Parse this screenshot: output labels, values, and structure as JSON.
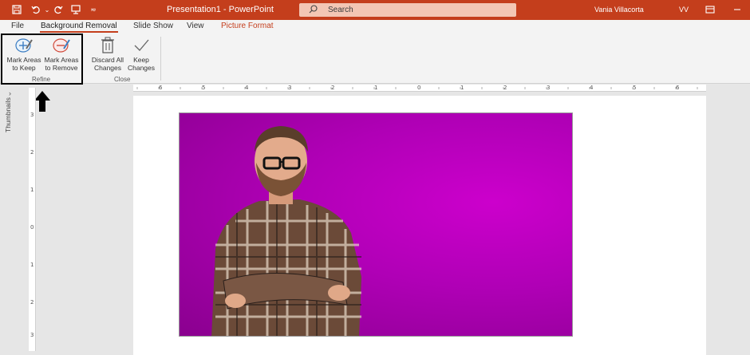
{
  "titlebar": {
    "doc_title": "Presentation1 - PowerPoint",
    "search_placeholder": "Search",
    "user_name": "Vania Villacorta",
    "user_initials": "VV",
    "bg_color": "#c43e1c"
  },
  "tabs": [
    "File",
    "Background Removal",
    "Slide Show",
    "View",
    "Picture Format"
  ],
  "ribbon": {
    "refine": {
      "mark_keep": [
        "Mark Areas",
        "to Keep"
      ],
      "mark_remove": [
        "Mark Areas",
        "to Remove"
      ],
      "label": "Refine"
    },
    "close": {
      "discard": [
        "Discard All",
        "Changes"
      ],
      "keep": [
        "Keep",
        "Changes"
      ],
      "label": "Close"
    }
  },
  "side_panel": {
    "thumbnails_label": "Thumbnails"
  },
  "ruler": {
    "horizontal": [
      "6",
      "5",
      "4",
      "3",
      "2",
      "1",
      "0",
      "1",
      "2",
      "3",
      "4",
      "5",
      "6"
    ],
    "vertical": [
      "3",
      "2",
      "1",
      "0",
      "1",
      "2",
      "3"
    ]
  },
  "slide": {
    "image_description_icon": "person-photo",
    "background_color": "#b400b8"
  }
}
